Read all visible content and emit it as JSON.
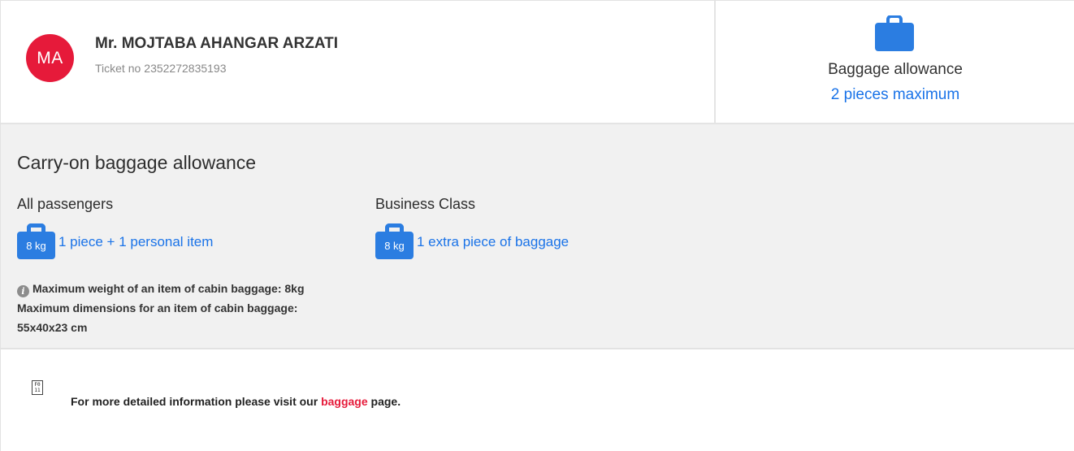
{
  "passenger": {
    "initials": "MA",
    "name": "Mr. MOJTABA AHANGAR ARZATI",
    "ticket_label": "Ticket no",
    "ticket_number": "2352272835193"
  },
  "allowance": {
    "icon": "suitcase-icon",
    "title": "Baggage allowance",
    "value": "2 pieces maximum"
  },
  "carry_on": {
    "title": "Carry-on baggage allowance",
    "columns": [
      {
        "title": "All passengers",
        "weight": "8 kg",
        "text": "1 piece + 1 personal item"
      },
      {
        "title": "Business Class",
        "weight": "8 kg",
        "text": "1 extra piece of baggage"
      }
    ],
    "info_icon": "info-icon",
    "info_text": "Maximum weight of an item of cabin baggage: 8kg Maximum dimensions for an item of cabin baggage: 55x40x23 cm"
  },
  "footer": {
    "glyph": "missing-glyph-icon",
    "prefix": "For more detailed information please visit our",
    "link_text": "baggage",
    "suffix": "page."
  },
  "colors": {
    "accent_blue": "#1a73e8",
    "brand_red": "#e61a3a",
    "section_bg": "#f1f1f1"
  }
}
